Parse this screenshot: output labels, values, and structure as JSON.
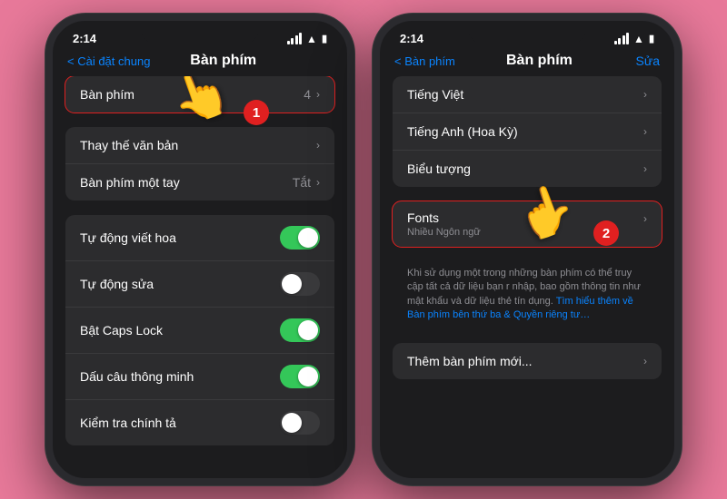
{
  "phone1": {
    "statusBar": {
      "time": "2:14",
      "signal": "signal",
      "wifi": "wifi",
      "battery": "battery"
    },
    "navBar": {
      "back": "< Cài đặt chung",
      "title": "Bàn phím",
      "action": ""
    },
    "sections": [
      {
        "id": "keyboards",
        "items": [
          {
            "label": "Bàn phím",
            "value": "4",
            "chevron": true,
            "highlighted": true
          }
        ]
      },
      {
        "id": "text",
        "items": [
          {
            "label": "Thay thế văn bản",
            "value": "",
            "chevron": true
          },
          {
            "label": "Bàn phím một tay",
            "value": "Tắt",
            "chevron": true
          }
        ]
      },
      {
        "id": "toggles",
        "items": [
          {
            "label": "Tự động viết hoa",
            "toggle": "on"
          },
          {
            "label": "Tự động sửa",
            "toggle": "off"
          },
          {
            "label": "Bật Caps Lock",
            "toggle": "on"
          },
          {
            "label": "Dấu câu thông minh",
            "toggle": "on"
          },
          {
            "label": "Kiểm tra chính tả",
            "toggle": "off"
          }
        ]
      }
    ],
    "step": "1"
  },
  "phone2": {
    "statusBar": {
      "time": "2:14",
      "signal": "signal",
      "wifi": "wifi",
      "battery": "battery"
    },
    "navBar": {
      "back": "< Bàn phím",
      "title": "Bàn phím",
      "action": "Sửa"
    },
    "sections": [
      {
        "id": "keyboards",
        "items": [
          {
            "label": "Tiếng Việt",
            "value": "",
            "chevron": true
          },
          {
            "label": "Tiếng Anh (Hoa Kỳ)",
            "value": "",
            "chevron": true
          },
          {
            "label": "Biểu tượng",
            "value": "",
            "chevron": true
          }
        ]
      },
      {
        "id": "fonts",
        "highlighted": true,
        "items": [
          {
            "label": "Fonts",
            "sublabel": "Nhiều Ngôn ngữ",
            "value": "",
            "chevron": true
          }
        ]
      },
      {
        "id": "info",
        "text": "Khi sử dụng một trong những bàn phím có thể truy cập tất cả dữ liệu bạn nhập, bao gồm thông tin như mật khẩu và dữ liệu thẻ tín dụng. ",
        "linkText": "Tìm hiểu thêm về Bàn phím bên thứ ba & Quyền riêng tư…"
      },
      {
        "id": "add",
        "items": [
          {
            "label": "Thêm bàn phím mới...",
            "value": "",
            "chevron": true
          }
        ]
      }
    ],
    "step": "2"
  }
}
